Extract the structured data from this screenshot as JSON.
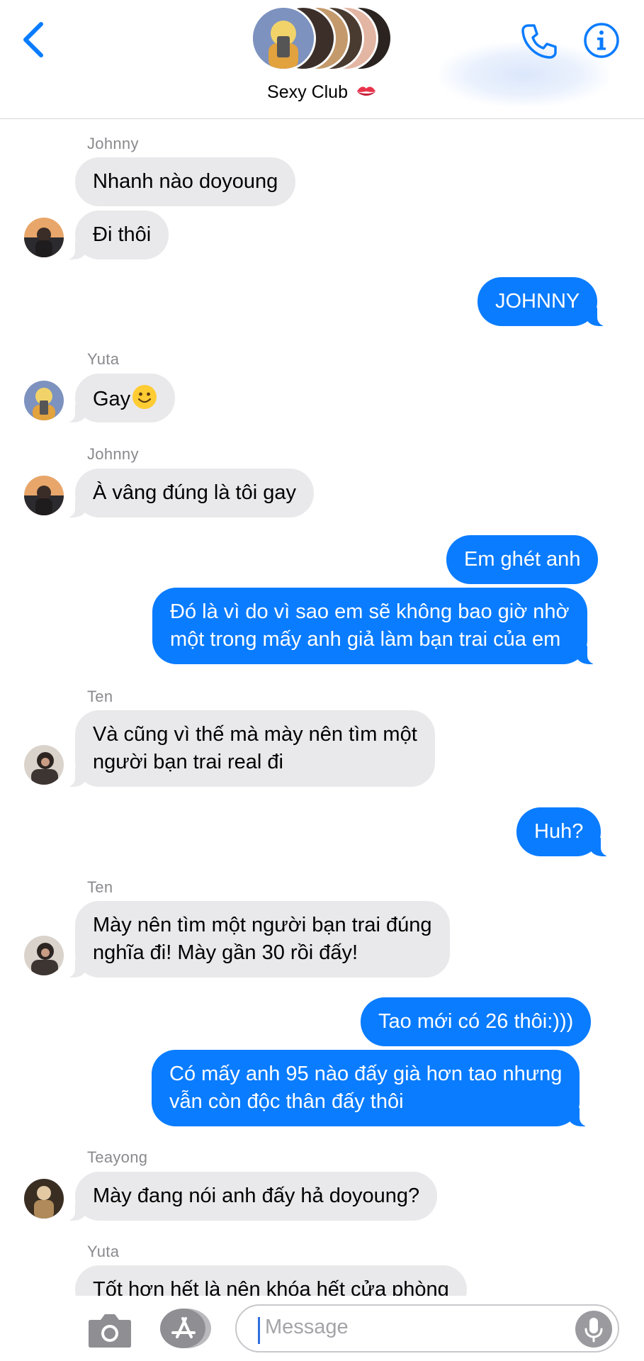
{
  "header": {
    "group_name": "Sexy Club",
    "name_emoji": "kiss-mark-emoji",
    "back_icon": "chevron-left-icon",
    "call_icon": "phone-icon",
    "info_icon": "info-icon"
  },
  "colors": {
    "accent": "#0a7cff",
    "incoming_bubble": "#e9e9eb",
    "sender_name": "#8a8a8e"
  },
  "messages": [
    {
      "sender": "Johnny",
      "direction": "incoming",
      "text": "Nhanh nào doyoung"
    },
    {
      "direction": "incoming",
      "text": "Đi thôi"
    },
    {
      "direction": "outgoing",
      "text": "JOHNNY"
    },
    {
      "sender": "Yuta",
      "direction": "incoming",
      "text": "Gay",
      "emoji": "slightly-smiling-face-emoji"
    },
    {
      "sender": "Johnny",
      "direction": "incoming",
      "text": "À vâng đúng là tôi gay"
    },
    {
      "direction": "outgoing",
      "text": "Em ghét anh"
    },
    {
      "direction": "outgoing",
      "lines": [
        "Đó là vì do vì sao em sẽ không bao giờ nhờ",
        "một trong mấy anh giả làm bạn trai của em"
      ]
    },
    {
      "sender": "Ten",
      "direction": "incoming",
      "lines": [
        "Và cũng vì thế mà mày nên tìm một",
        "người bạn trai real đi"
      ]
    },
    {
      "direction": "outgoing",
      "text": "Huh?"
    },
    {
      "sender": "Ten",
      "direction": "incoming",
      "lines": [
        "Mày nên tìm một người bạn trai đúng",
        "nghĩa đi! Mày gần 30 rồi đấy!"
      ]
    },
    {
      "direction": "outgoing",
      "text": "Tao mới có 26 thôi:)))"
    },
    {
      "direction": "outgoing",
      "lines": [
        "Có mấy anh 95 nào đấy già hơn tao nhưng",
        "vẫn còn độc thân đấy thôi"
      ]
    },
    {
      "sender": "Teayong",
      "direction": "incoming",
      "text": "Mày đang nói anh đấy hả doyoung?"
    },
    {
      "sender": "Yuta",
      "direction": "incoming",
      "text": "Tốt hơn hết là nên khóa hết cửa phòng"
    }
  ],
  "input": {
    "placeholder": "Message",
    "camera_icon": "camera-icon",
    "apps_icon": "app-store-icon",
    "mic_icon": "microphone-icon"
  }
}
